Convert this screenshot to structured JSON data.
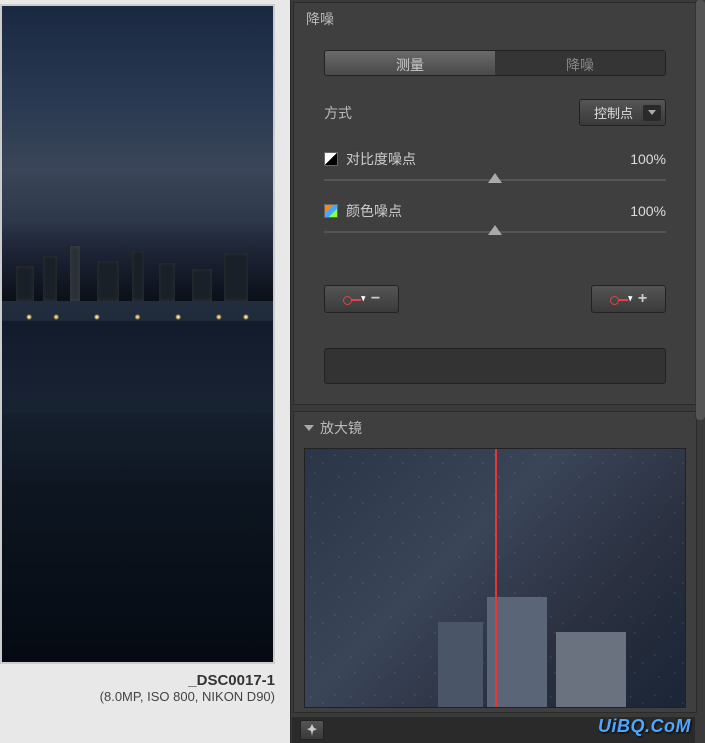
{
  "leftPanel": {
    "imageName": "_DSC0017-1",
    "imageMeta": "(8.0MP, ISO 800, NIKON D90)"
  },
  "noisePanel": {
    "title": "降噪",
    "tabs": {
      "measure": "测量",
      "denoise": "降噪"
    },
    "method": {
      "label": "方式",
      "value": "控制点"
    },
    "sliders": {
      "contrast": {
        "label": "对比度噪点",
        "value": "100%"
      },
      "color": {
        "label": "颜色噪点",
        "value": "100%"
      }
    },
    "buttons": {
      "minus": "−",
      "plus": "+"
    }
  },
  "magnifier": {
    "title": "放大镜"
  },
  "watermark": "UiBQ.CoM"
}
